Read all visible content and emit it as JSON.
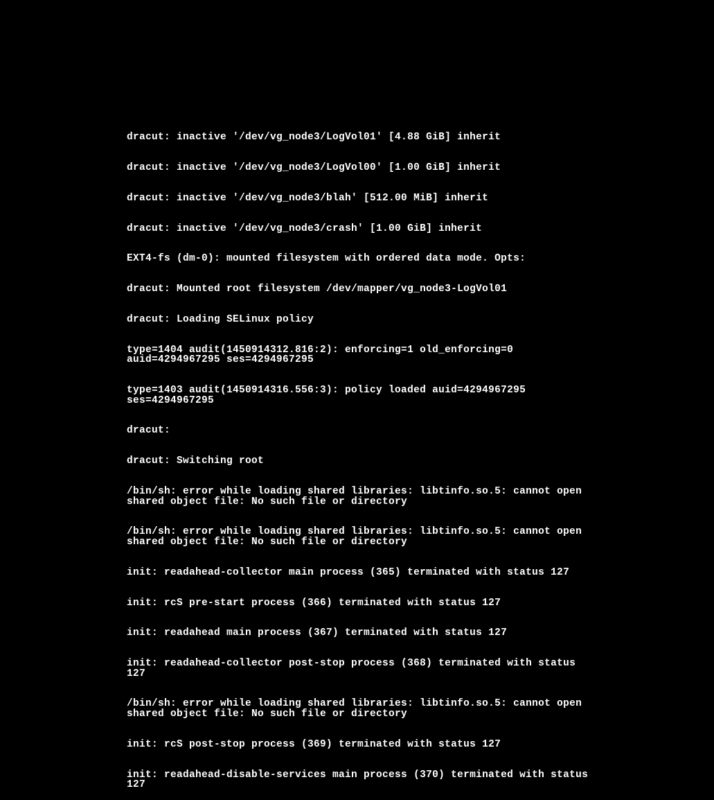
{
  "terminal": {
    "lines": [
      "dracut: inactive '/dev/vg_node3/LogVol01' [4.88 GiB] inherit",
      "dracut: inactive '/dev/vg_node3/LogVol00' [1.00 GiB] inherit",
      "dracut: inactive '/dev/vg_node3/blah' [512.00 MiB] inherit",
      "dracut: inactive '/dev/vg_node3/crash' [1.00 GiB] inherit",
      "EXT4-fs (dm-0): mounted filesystem with ordered data mode. Opts:",
      "dracut: Mounted root filesystem /dev/mapper/vg_node3-LogVol01",
      "dracut: Loading SELinux policy",
      "type=1404 audit(1450914312.816:2): enforcing=1 old_enforcing=0 auid=4294967295 ses=4294967295",
      "type=1403 audit(1450914316.556:3): policy loaded auid=4294967295 ses=4294967295",
      "dracut:",
      "dracut: Switching root",
      "/bin/sh: error while loading shared libraries: libtinfo.so.5: cannot open shared object file: No such file or directory",
      "/bin/sh: error while loading shared libraries: libtinfo.so.5: cannot open shared object file: No such file or directory",
      "init: readahead-collector main process (365) terminated with status 127",
      "init: rcS pre-start process (366) terminated with status 127",
      "init: readahead main process (367) terminated with status 127",
      "init: readahead-collector post-stop process (368) terminated with status 127",
      "/bin/sh: error while loading shared libraries: libtinfo.so.5: cannot open shared object file: No such file or directory",
      "init: rcS post-stop process (369) terminated with status 127",
      "init: readahead-disable-services main process (370) terminated with status 127"
    ]
  }
}
